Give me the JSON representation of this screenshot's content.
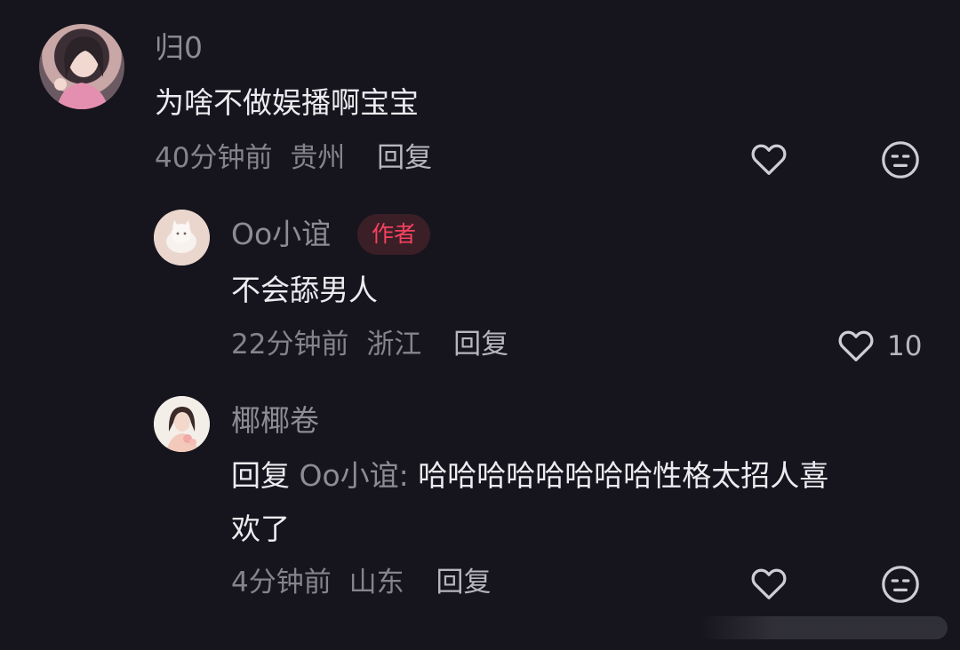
{
  "comments": [
    {
      "username": "归0",
      "text": "为啥不做娱播啊宝宝",
      "time": "40分钟前",
      "location": "贵州",
      "reply_label": "回复"
    },
    {
      "username": "Oo小谊",
      "badge": "作者",
      "text": "不会舔男人",
      "time": "22分钟前",
      "location": "浙江",
      "reply_label": "回复",
      "like_count": "10"
    },
    {
      "username": "椰椰卷",
      "reply_prefix": "回复",
      "reply_target": "Oo小谊:",
      "text_line1": "哈哈哈哈哈哈哈哈性格太招人喜",
      "text_line2": "欢了",
      "time": "4分钟前",
      "location": "山东",
      "reply_label": "回复"
    }
  ],
  "icons": {
    "like": "heart-outline-icon",
    "dislike": "neutral-face-icon"
  },
  "colors": {
    "background": "#16151d",
    "author_badge_text": "#f6425f",
    "author_badge_bg": "#3a1f27"
  }
}
